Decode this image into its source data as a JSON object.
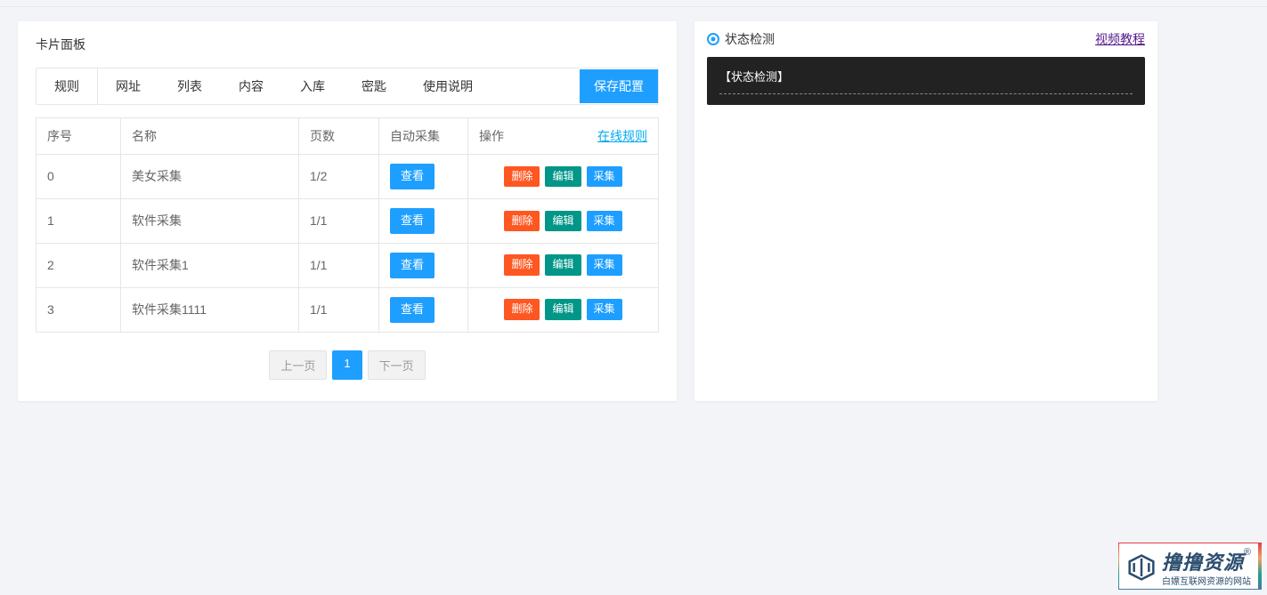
{
  "left": {
    "title": "卡片面板",
    "tabs": [
      "规则",
      "网址",
      "列表",
      "内容",
      "入库",
      "密匙",
      "使用说明"
    ],
    "save_button": "保存配置",
    "table": {
      "headers": {
        "num": "序号",
        "name": "名称",
        "pages": "页数",
        "auto": "自动采集",
        "ops": "操作",
        "online_rule_link": "在线规则"
      },
      "view_button": "查看",
      "op_buttons": {
        "delete": "删除",
        "edit": "编辑",
        "collect": "采集"
      },
      "rows": [
        {
          "num": "0",
          "name": "美女采集",
          "pages": "1/2"
        },
        {
          "num": "1",
          "name": "软件采集",
          "pages": "1/1"
        },
        {
          "num": "2",
          "name": "软件采集1",
          "pages": "1/1"
        },
        {
          "num": "3",
          "name": "软件采集1111",
          "pages": "1/1"
        }
      ]
    },
    "pagination": {
      "prev": "上一页",
      "current": "1",
      "next": "下一页"
    }
  },
  "right": {
    "title": "状态检测",
    "video_link": "视频教程",
    "status_label": "【状态检测】"
  },
  "watermark": {
    "main": "撸撸资源",
    "reg": "®",
    "sub": "白嫖互联网资源的网站"
  }
}
